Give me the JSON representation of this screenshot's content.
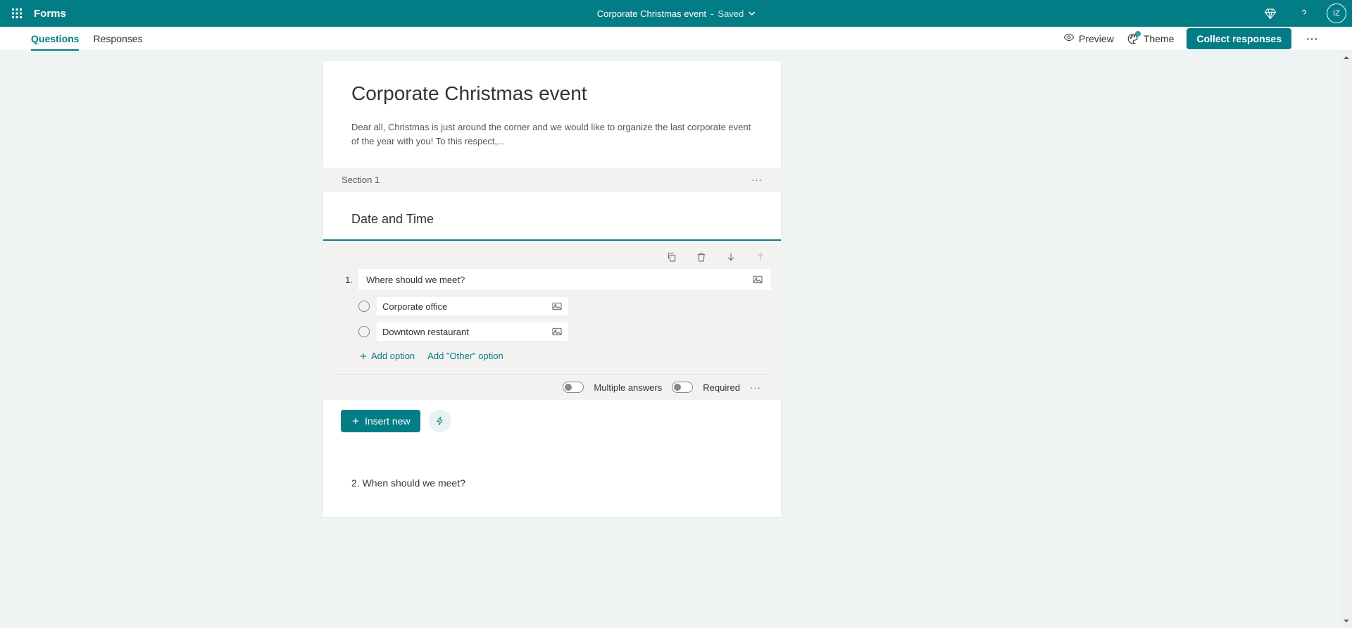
{
  "header": {
    "app_name": "Forms",
    "doc_title": "Corporate Christmas event",
    "save_status": "Saved",
    "avatar_initials": "IZ"
  },
  "cmdbar": {
    "tabs": {
      "questions": "Questions",
      "responses": "Responses"
    },
    "preview": "Preview",
    "theme": "Theme",
    "collect": "Collect responses"
  },
  "form": {
    "title": "Corporate Christmas event",
    "description": "Dear all, Christmas is just around the corner and we would like to organize the last corporate event of the year with you! To this respect,..."
  },
  "section": {
    "header_label": "Section 1",
    "title": "Date and Time"
  },
  "question1": {
    "number": "1.",
    "text": "Where should we meet?",
    "options": [
      "Corporate office",
      "Downtown restaurant"
    ],
    "add_option": "Add option",
    "add_other": "Add \"Other\" option",
    "multiple_answers_label": "Multiple answers",
    "required_label": "Required"
  },
  "insert_new_label": "Insert new",
  "question2": {
    "number": "2.",
    "text": "When should we meet?"
  }
}
